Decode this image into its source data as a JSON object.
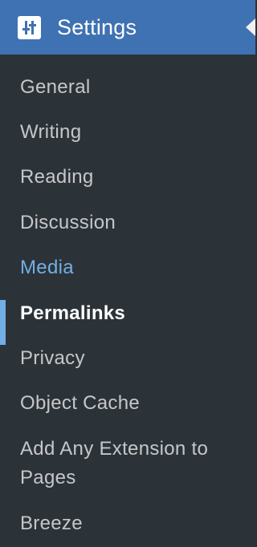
{
  "header": {
    "title": "Settings",
    "icon": "settings-sliders-icon",
    "background": "#3f72b2"
  },
  "colors": {
    "sidebar_background": "#2c3338",
    "current_item": "#72aee6",
    "bold_item": "#ffffff",
    "default_item": "#f0f0f1"
  },
  "items": [
    {
      "label": "General"
    },
    {
      "label": "Writing"
    },
    {
      "label": "Reading"
    },
    {
      "label": "Discussion"
    },
    {
      "label": "Media",
      "state": "current"
    },
    {
      "label": "Permalinks",
      "state": "bold"
    },
    {
      "label": "Privacy"
    },
    {
      "label": "Object Cache"
    },
    {
      "label": "Add Any Extension to Pages"
    },
    {
      "label": "Breeze"
    }
  ]
}
